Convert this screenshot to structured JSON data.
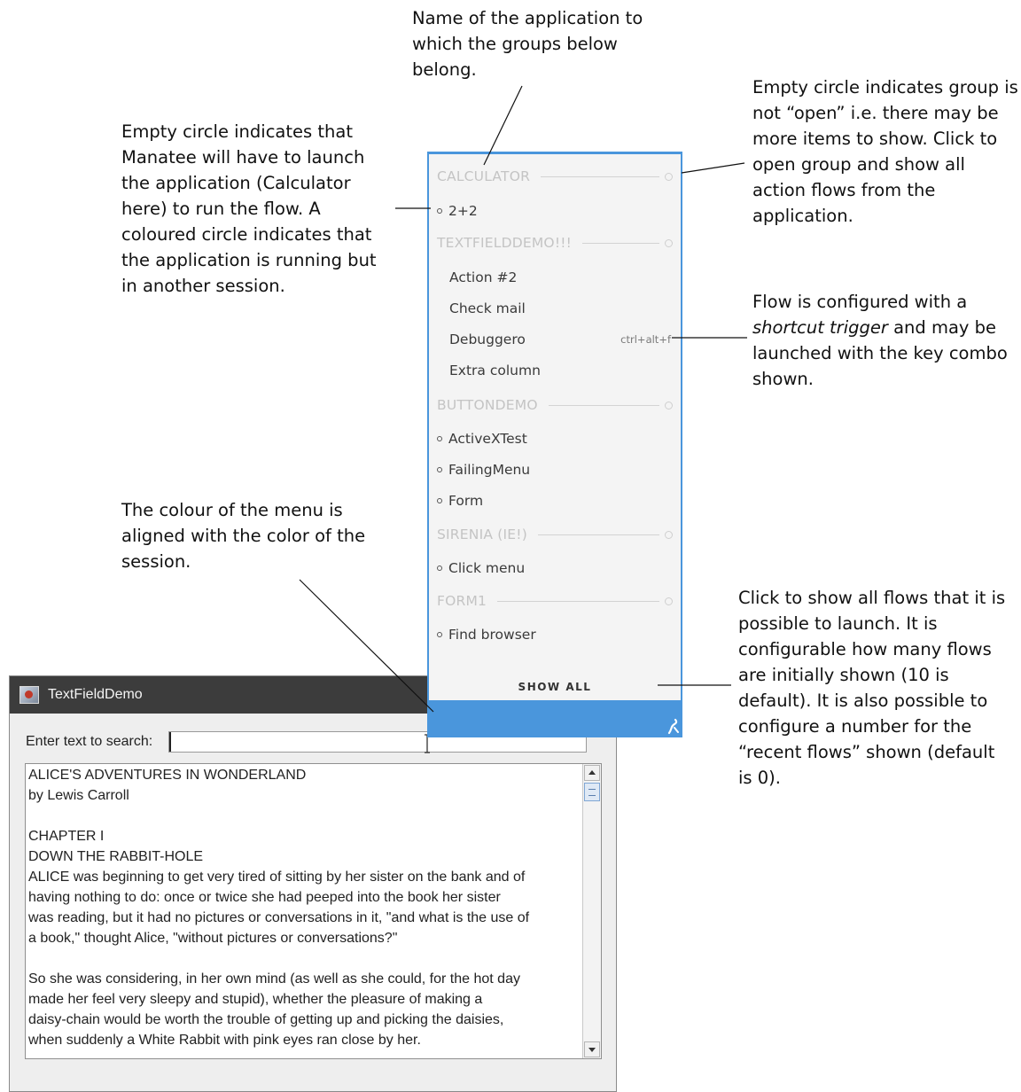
{
  "annotations": {
    "app_name": [
      "Name of the application to",
      "which the groups below",
      "belong."
    ],
    "empty_circle_launch": [
      "Empty circle indicates that",
      "Manatee will have to launch",
      "the application (Calculator",
      "here) to run the flow. A",
      "coloured circle indicates that",
      "the application is running but",
      "in another session."
    ],
    "group_not_open": [
      "Empty circle indicates group is",
      "not “open” i.e. there may be",
      "more items to show. Click to",
      "open group and show all",
      "action flows from the",
      "application."
    ],
    "shortcut_trigger": {
      "line1": "Flow is configured with a",
      "line2_em": "shortcut trigger",
      "line2_rest": " and may be",
      "line3": "launched with the key combo",
      "line4": "shown."
    },
    "menu_colour": [
      "The colour of the menu is",
      "aligned with the color of the",
      "session."
    ],
    "show_all": [
      "Click to show all flows that it is",
      "possible to launch. It is",
      "configurable how many flows",
      "are initially shown (10 is",
      "default). It is also possible to",
      "configure a number for the",
      "“recent flows” shown (default",
      "is 0)."
    ]
  },
  "menu": {
    "groups": [
      {
        "name": "CALCULATOR",
        "items": [
          {
            "label": "2+2",
            "launch_circle": true
          }
        ]
      },
      {
        "name": "TEXTFIELDDEMO!!!",
        "items": [
          {
            "label": "Action #2",
            "launch_circle": false
          },
          {
            "label": "Check mail",
            "launch_circle": false
          },
          {
            "label": "Debuggero",
            "launch_circle": false,
            "shortcut": "ctrl+alt+f"
          },
          {
            "label": "Extra column",
            "launch_circle": false
          }
        ]
      },
      {
        "name": "BUTTONDEMO",
        "items": [
          {
            "label": "ActiveXTest",
            "launch_circle": true
          },
          {
            "label": "FailingMenu",
            "launch_circle": true
          },
          {
            "label": "Form",
            "launch_circle": true
          }
        ]
      },
      {
        "name": "SIRENIA (IE!)",
        "items": [
          {
            "label": "Click menu",
            "launch_circle": true
          }
        ]
      },
      {
        "name": "FORM1",
        "items": [
          {
            "label": "Find browser",
            "launch_circle": true
          }
        ]
      }
    ],
    "show_all_label": "SHOW ALL",
    "accent_color": "#4a96dc"
  },
  "window": {
    "title": "TextFieldDemo",
    "search_label": "Enter text to search:",
    "search_value": "",
    "text_lines": [
      "ALICE'S ADVENTURES IN WONDERLAND",
      "by Lewis Carroll",
      "",
      "CHAPTER I",
      "DOWN THE RABBIT-HOLE",
      "ALICE was beginning to get very tired of sitting by her sister on the bank and of",
      "having nothing to do: once or twice she had peeped into the book her sister",
      "was reading, but it had no pictures or conversations in it, \"and what is the use of",
      "a book,\" thought Alice, \"without pictures or conversations?\"",
      "",
      "So she was considering, in her own mind (as well as she could, for the hot day",
      "made her feel very sleepy and stupid), whether the pleasure of making a",
      "daisy-chain would be worth the trouble of getting up and picking the daisies,",
      "when suddenly a White Rabbit with pink eyes ran close by her."
    ]
  }
}
